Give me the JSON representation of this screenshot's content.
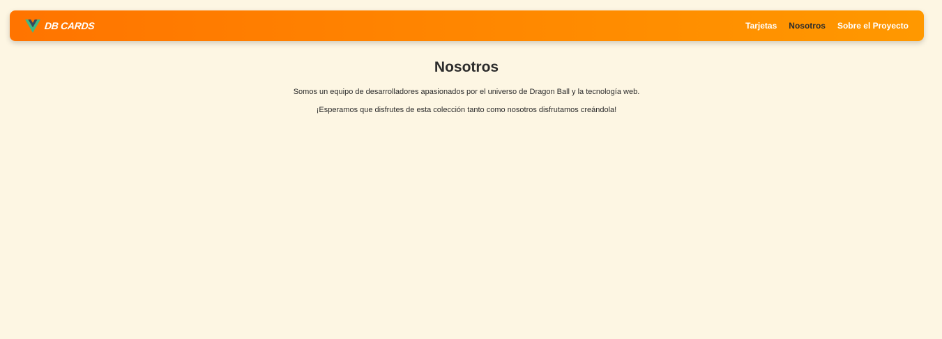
{
  "colors": {
    "background": "#fdf6e3",
    "navbar_gradient_start": "#ff7400",
    "navbar_gradient_end": "#ff9800",
    "nav_text": "#ffffff",
    "nav_active_text": "#2c2c2c",
    "logo_outer": "#41b883",
    "logo_inner": "#35495e"
  },
  "navbar": {
    "logo_icon": "vue-logo-icon",
    "brand": "DB CARDS",
    "links": [
      {
        "label": "Tarjetas",
        "active": false
      },
      {
        "label": "Nosotros",
        "active": true
      },
      {
        "label": "Sobre el Proyecto",
        "active": false
      }
    ]
  },
  "main": {
    "title": "Nosotros",
    "paragraphs": [
      "Somos un equipo de desarrolladores apasionados por el universo de Dragon Ball y la tecnología web.",
      "¡Esperamos que disfrutes de esta colección tanto como nosotros disfrutamos creándola!"
    ]
  }
}
